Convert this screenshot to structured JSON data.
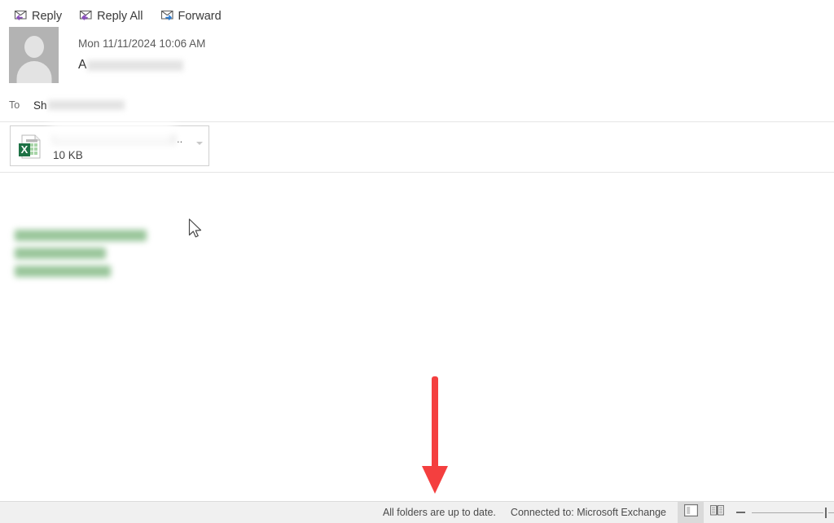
{
  "action_bar": {
    "buttons": [
      {
        "label": "Reply",
        "icon": "reply-envelope-icon"
      },
      {
        "label": "Reply All",
        "icon": "reply-all-envelope-icon"
      },
      {
        "label": "Forward",
        "icon": "forward-envelope-icon"
      }
    ]
  },
  "message": {
    "sent_date": "Mon 11/11/2024 10:06 AM",
    "sender_visible_prefix": "A",
    "sender_redacted": true,
    "to_label": "To",
    "to_visible_prefix": "Sh",
    "to_redacted": true,
    "avatar": "default-person-avatar"
  },
  "attachment": {
    "file_type": "excel",
    "name_redacted": true,
    "name_ellipsis": "..",
    "size": "10 KB",
    "dropdown": "attachment-menu-chevron"
  },
  "body": {
    "signature_lines_redacted": 3,
    "signature_color": "#5aa25c"
  },
  "annotation": {
    "type": "down-arrow",
    "color": "#f43f3f"
  },
  "status_bar": {
    "folders_status": "All folders are up to date.",
    "connection_status": "Connected to: Microsoft Exchange",
    "reading_pane_button": "normal-view-icon",
    "reading_view_button": "reading-view-icon",
    "zoom_out_label": "−",
    "zoom_level_percent": 90
  },
  "colors": {
    "reply_arrow": "#8a4fbe",
    "forward_arrow": "#2b7cd3",
    "excel_green": "#1e7145",
    "annotation_red": "#f43f3f",
    "status_bg": "#f0f0f0"
  }
}
